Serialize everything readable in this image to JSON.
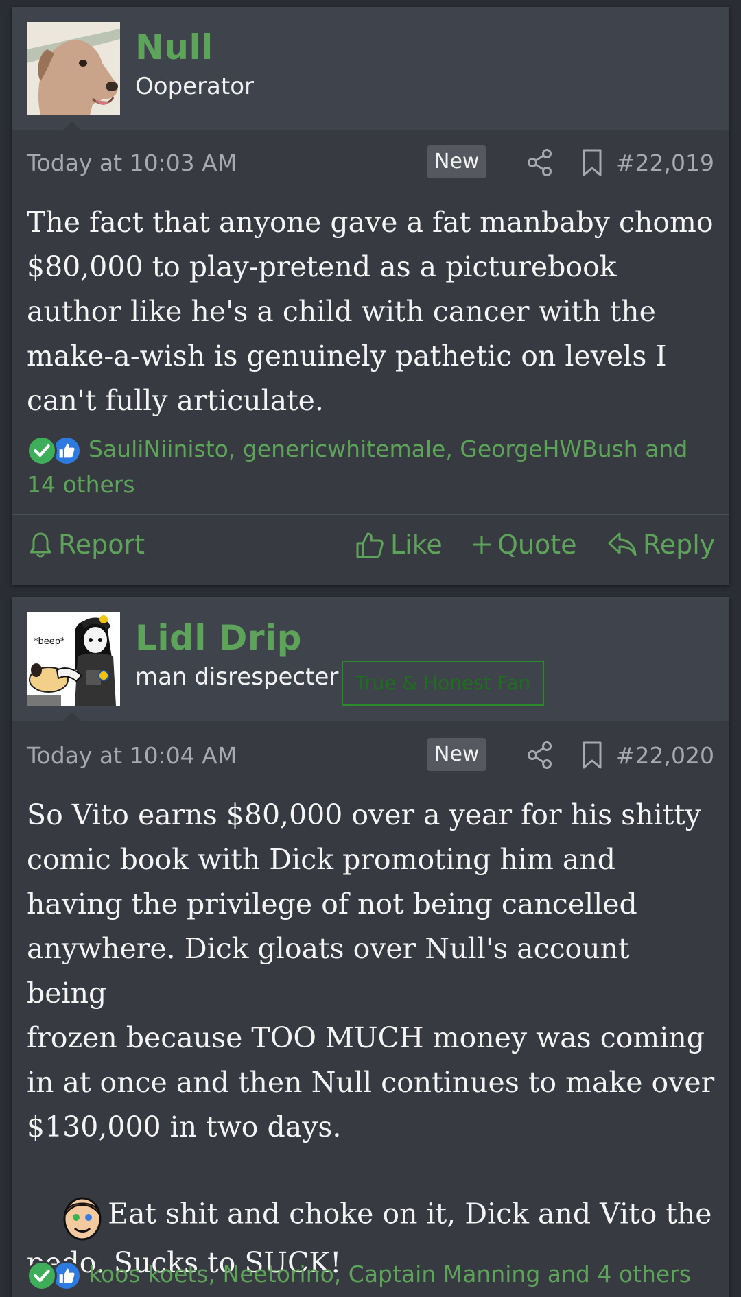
{
  "posts": [
    {
      "username": "Null",
      "user_title": "Ooperator",
      "user_banner": "",
      "date": "Today at 10:03 AM",
      "badge": "New",
      "post_number": "#22,019",
      "message": "The fact that anyone gave a fat manbaby chomo\n$80,000 to play-pretend as a picturebook\nauthor like he's a child with cancer with the\nmake-a-wish is genuinely pathetic on levels I\ncan't fully articulate.",
      "reactions_text": "SauliNiinisto, genericwhitemale, GeorgeHWBush and 14 others",
      "actions": {
        "report": "Report",
        "like": "Like",
        "quote": "Quote",
        "reply": "Reply"
      }
    },
    {
      "username": "Lidl Drip",
      "user_title": "man disrespecter",
      "user_banner": "True & Honest Fan",
      "avatar_caption": "*beep*",
      "date": "Today at 10:04 AM",
      "badge": "New",
      "post_number": "#22,020",
      "message": "So Vito earns $80,000 over a year for his shitty\ncomic book with Dick promoting him and\nhaving the privilege of not being cancelled\nanywhere. Dick gloats over Null's account being\nfrozen because TOO MUCH money was coming\nin at once and then Null continues to make over\n$130,000 in two days.",
      "message_tail": "Eat shit and choke on it, Dick and Vito the\npedo. Sucks to SUCK!",
      "reactions_text": "koos koets, Neetorino, Captain Manning and 4 others"
    }
  ],
  "colors": {
    "accent_green": "#5ea35a",
    "banner_green": "#2c8a2c",
    "post_bg": "#373a41",
    "header_bg": "#3f434b",
    "page_bg": "#2a2d33"
  },
  "icons": [
    "share-icon",
    "bookmark-icon",
    "bell-icon",
    "thumbs-up-icon",
    "plus-icon",
    "reply-icon",
    "check-reaction-icon",
    "like-reaction-icon"
  ]
}
